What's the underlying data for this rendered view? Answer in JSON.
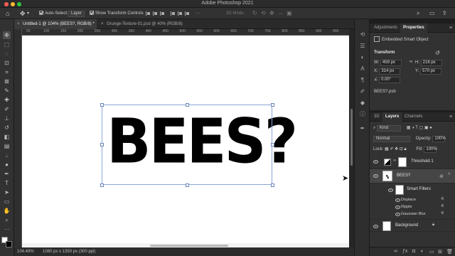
{
  "app": {
    "title": "Adobe Photoshop 2021"
  },
  "options_bar": {
    "auto_select_label": "Auto-Select:",
    "auto_select_target": "Layer",
    "show_transform_controls_label": "Show Transform Controls",
    "mode_3d_label": "3D Mode:"
  },
  "tabs": [
    {
      "label": "Untitled-1 @ 104% (BEES?, RGB/8) *"
    },
    {
      "label": "Grunge-Texture-01.psd @ 40% (RGB/8)"
    }
  ],
  "ruler": {
    "ticks": [
      "50",
      "100",
      "150",
      "200",
      "250",
      "300",
      "350",
      "400",
      "450",
      "500",
      "550",
      "600",
      "650",
      "700",
      "750",
      "800",
      "850",
      "900",
      "950"
    ]
  },
  "canvas": {
    "text": "BEES?"
  },
  "status": {
    "zoom": "104.49%",
    "doc_info": "1080 px x 1350 px (300 ppi)"
  },
  "properties": {
    "tabs": [
      "Adjustments",
      "Properties"
    ],
    "type_label": "Embedded Smart Object",
    "transform_label": "Transform",
    "w_label": "W:",
    "w_value": "459 px",
    "h_label": "H:",
    "h_value": "216 px",
    "x_label": "X:",
    "x_value": "314 px",
    "y_label": "Y:",
    "y_value": "570 px",
    "angle_value": "0.00°",
    "file_name": "BEES?.psb"
  },
  "layers_panel": {
    "tabs": [
      "3D",
      "Layers",
      "Channels"
    ],
    "filter_label": "Kind",
    "blend_mode": "Normal",
    "opacity_label": "Opacity:",
    "opacity_value": "100%",
    "lock_label": "Lock:",
    "fill_label": "Fill:",
    "fill_value": "100%",
    "layers": [
      {
        "name": "Threshold 1"
      },
      {
        "name": "BEES?"
      },
      {
        "name": "Smart Filters"
      },
      {
        "name": "Displace"
      },
      {
        "name": "Ripple"
      },
      {
        "name": "Gaussian Blur"
      },
      {
        "name": "Background"
      }
    ]
  },
  "colors": {
    "accent": "#8aa6d6",
    "panel_bg": "#323232",
    "canvas_bg": "#ffffff"
  }
}
